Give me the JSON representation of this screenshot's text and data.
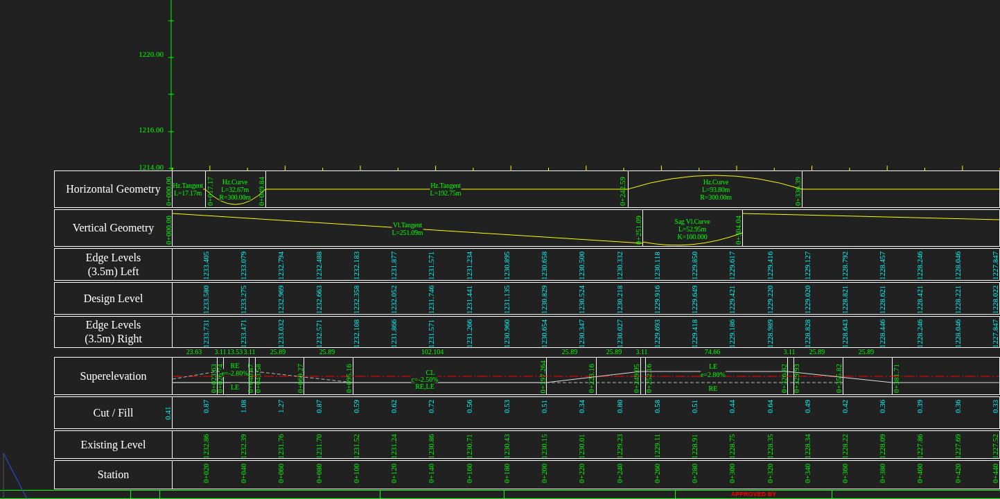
{
  "elevation_axis": {
    "tick_labels": [
      "1220.00",
      "1216.00",
      "1214.00"
    ]
  },
  "horizontal_geometry": {
    "label": "Horizontal Geometry",
    "station_labels": [
      "0+000.00",
      "0+017.17",
      "0+049.84",
      "0+242.59",
      "0+336.39"
    ],
    "elements": [
      {
        "kind": "tangent",
        "lines": [
          "Hz.Tangent",
          "L=17.17m"
        ]
      },
      {
        "kind": "curve",
        "lines": [
          "Hz.Curve",
          "L=32.67m",
          "R=300.00m"
        ]
      },
      {
        "kind": "tangent",
        "lines": [
          "Hz.Tangent",
          "L=192.75m"
        ]
      },
      {
        "kind": "curve",
        "lines": [
          "Hz.Curve",
          "L=93.80m",
          "R=300.00m"
        ]
      }
    ]
  },
  "vertical_geometry": {
    "label": "Vertical Geometry",
    "station_labels": [
      "0+000.00",
      "0+251.09",
      "0+304.04"
    ],
    "elements": [
      {
        "kind": "tangent",
        "lines": [
          "Vl.Tangent",
          "L=251.09m"
        ]
      },
      {
        "kind": "sag_curve",
        "lines": [
          "Sag Vl.Curve",
          "L=52.95m",
          "K=100.000"
        ]
      }
    ]
  },
  "edge_levels_left": {
    "label_lines": [
      "Edge Levels",
      "(3.5m) Left"
    ],
    "values": [
      "1233.405",
      "1233.079",
      "1232.794",
      "1232.488",
      "1232.183",
      "1231.877",
      "1231.571",
      "1231.234",
      "1230.895",
      "1230.658",
      "1230.500",
      "1230.332",
      "1230.118",
      "1229.850",
      "1229.617",
      "1229.416",
      "1229.127",
      "1228.792",
      "1228.457",
      "1228.246",
      "1228.046",
      "1227.847"
    ]
  },
  "design_level": {
    "label_lines": [
      "Design Level"
    ],
    "values": [
      "1233.580",
      "1233.275",
      "1232.969",
      "1232.663",
      "1232.358",
      "1232.052",
      "1231.746",
      "1231.441",
      "1231.135",
      "1230.829",
      "1230.524",
      "1230.218",
      "1229.916",
      "1229.649",
      "1229.421",
      "1229.220",
      "1229.020",
      "1228.821",
      "1228.621",
      "1228.421",
      "1228.221",
      "1228.022"
    ]
  },
  "edge_levels_right": {
    "label_lines": [
      "Edge Levels",
      "(3.5m) Right"
    ],
    "values": [
      "1233.731",
      "1233.471",
      "1233.032",
      "1232.571",
      "1232.108",
      "1231.866",
      "1231.571",
      "1231.266",
      "1230.960",
      "1230.654",
      "1230.347",
      "1230.027",
      "1229.693",
      "1229.418",
      "1229.186",
      "1228.989",
      "1228.828",
      "1228.643",
      "1228.446",
      "1228.246",
      "1228.046",
      "1227.847"
    ]
  },
  "segment_lengths": [
    "23.63",
    "3.11",
    "13.53",
    "3.11",
    "25.89",
    "25.89",
    "102.104",
    "25.89",
    "25.89",
    "3.11",
    "74.66",
    "3.11",
    "25.89",
    "25.89"
  ],
  "superelevation": {
    "label": "Superelevation",
    "station_labels": [
      "0+023.63",
      "0+026.74",
      "0+040.47",
      "0+043.58",
      "0+069.27",
      "0+095.16",
      "0+197.264",
      "0+223.16",
      "0+249.05",
      "0+252.16",
      "0+326.82",
      "0+329.93",
      "0+355.82",
      "0+381.71"
    ],
    "notes": [
      "RE",
      "e=-2.80%",
      "LE",
      "CL",
      "c=-2.50%",
      "RE,LE",
      "LE",
      "e=2.80%",
      "RE"
    ]
  },
  "cut_fill": {
    "label_lines": [
      "Cut / Fill"
    ],
    "start_value": "0.41",
    "values": [
      "0.87",
      "1.08",
      "1.27",
      "0.87",
      "0.59",
      "0.62",
      "0.72",
      "0.56",
      "0.53",
      "0.51",
      "0.34",
      "0.80",
      "0.58",
      "0.51",
      "0.44",
      "0.64",
      "0.49",
      "0.42",
      "0.36",
      "0.39",
      "0.36",
      "0.33"
    ]
  },
  "existing_level": {
    "label_lines": [
      "Existing Level"
    ],
    "values": [
      "1232.86",
      "1232.39",
      "1231.76",
      "1231.70",
      "1231.52",
      "1231.24",
      "1230.86",
      "1230.71",
      "1230.43",
      "1230.15",
      "1230.01",
      "1229.23",
      "1229.11",
      "1228.91",
      "1228.75",
      "1228.35",
      "1228.34",
      "1228.22",
      "1228.09",
      "1227.86",
      "1227.69",
      "1227.52"
    ]
  },
  "station": {
    "label_lines": [
      "Station"
    ],
    "values": [
      "0+020",
      "0+040",
      "0+060",
      "0+080",
      "0+100",
      "0+120",
      "0+140",
      "0+160",
      "0+180",
      "0+200",
      "0+220",
      "0+240",
      "0+260",
      "0+280",
      "0+300",
      "0+320",
      "0+340",
      "0+360",
      "0+380",
      "0+400",
      "0+420",
      "0+440"
    ]
  },
  "title_block": {
    "approved_label": "APPROVED BY"
  }
}
